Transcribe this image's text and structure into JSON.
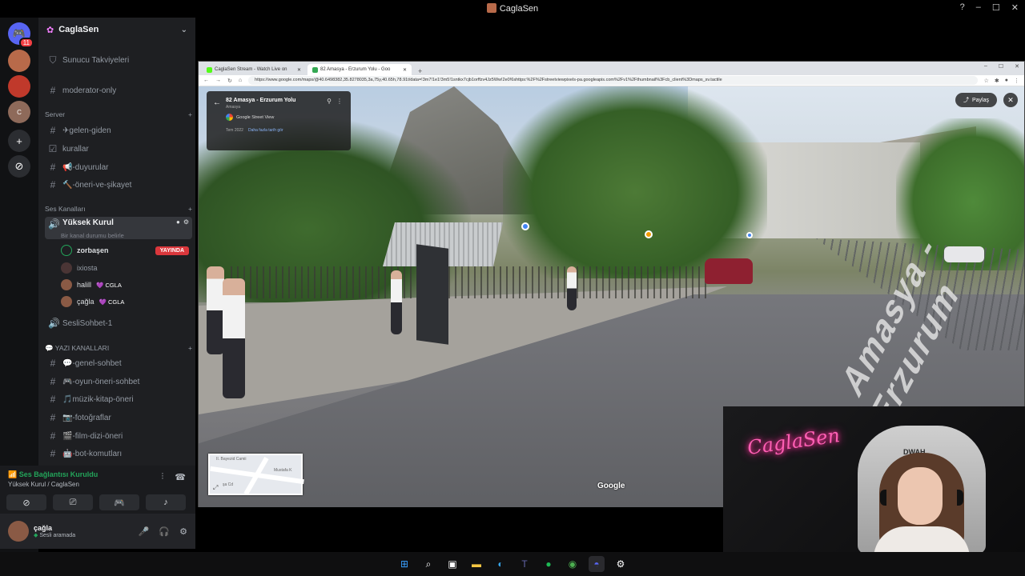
{
  "window": {
    "title": "CaglaSen",
    "controls": [
      "?",
      "–",
      "☐",
      "✕"
    ]
  },
  "brand_logo_text": "",
  "rail": {
    "badge_count": "11",
    "servers": [
      {
        "name": "home",
        "color": "#5865f2"
      },
      {
        "name": "server-1",
        "color": "#b86a4a"
      },
      {
        "name": "server-2",
        "color": "#c0392b"
      },
      {
        "name": "server-3",
        "color": "#8e6a5a"
      },
      {
        "name": "add-server",
        "color": "#2b2d31"
      },
      {
        "name": "discover",
        "color": "#2b2d31"
      }
    ]
  },
  "sidebar": {
    "guild_name": "CaglaSen",
    "top_items": [
      {
        "label": "Sunucu Takviyeleri"
      },
      {
        "label": "moderator-only"
      }
    ],
    "server_category": "Server",
    "server_channels": [
      {
        "label": "✈gelen-giden"
      },
      {
        "label": "kurallar"
      },
      {
        "label": "📢-duyurular"
      },
      {
        "label": "🔨-öneri-ve-şikayet"
      }
    ],
    "voice_category": "Ses Kanalları",
    "active_voice_channel": "Yüksek Kurul",
    "voice_status_hint": "Bir kanal durumu belirle",
    "voice_users": [
      {
        "name": "zorbaşen",
        "live": "YAYINDA",
        "tag": ""
      },
      {
        "name": "ixiosta",
        "live": "",
        "tag": ""
      },
      {
        "name": "halill",
        "live": "",
        "tag": "💜 CGLA"
      },
      {
        "name": "çağla",
        "live": "",
        "tag": "💜 CGLA"
      }
    ],
    "other_voice_channel": "SesliSohbet-1",
    "text_category": "💬 YAZI KANALLARI",
    "text_channels": [
      {
        "label": "💬-genel-sohbet"
      },
      {
        "label": "🎮-oyun-öneri-sohbet"
      },
      {
        "label": "🎵müzik-kitap-öneri"
      },
      {
        "label": "📷-fotoğraflar"
      },
      {
        "label": "🎬-film-dizi-öneri"
      },
      {
        "label": "🤖-bot-komutları"
      }
    ]
  },
  "voice_panel": {
    "status": "Ses Bağlantısı Kuruldu",
    "location": "Yüksek Kurul / CaglaSen"
  },
  "user_panel": {
    "name": "çağla",
    "status": "Sesli aramada"
  },
  "browser": {
    "tabs": [
      {
        "label": "CaglaSen Stream - Watch Live on",
        "color": "#53fc18"
      },
      {
        "label": "82 Amasya - Erzurum Yolu - Goo",
        "color": "#34a853"
      }
    ],
    "url": "https://www.google.com/maps/@40.6498382,35.8278035,3a,75y,40.65h,78.91t/data=!3m7!1e1!3m5!1sntkx7cjb1orffzv4Jz5Ww!2e0!6shttps:%2F%2Fstreetviewpixels-pa.googleapis.com%2Fv1%2Fthumbnail%3Fcb_client%3Dmaps_sv.tactile"
  },
  "street_view": {
    "location_title": "82 Amasya - Erzurum Yolu",
    "region": "Amasya",
    "provider": "Google Street View",
    "date": "Tem 2022",
    "more_dates": "Daha fazla tarih gör",
    "share_label": "Paylaş",
    "road_marking": "Amasya - Erzurum",
    "minimap_labels": [
      "II. Bayezid Camii",
      "Mustafa K",
      "şa Cd"
    ],
    "google_logo": "Google"
  },
  "webcam": {
    "neon_text": "CaglaSen",
    "chair_brand": "DWAH"
  }
}
